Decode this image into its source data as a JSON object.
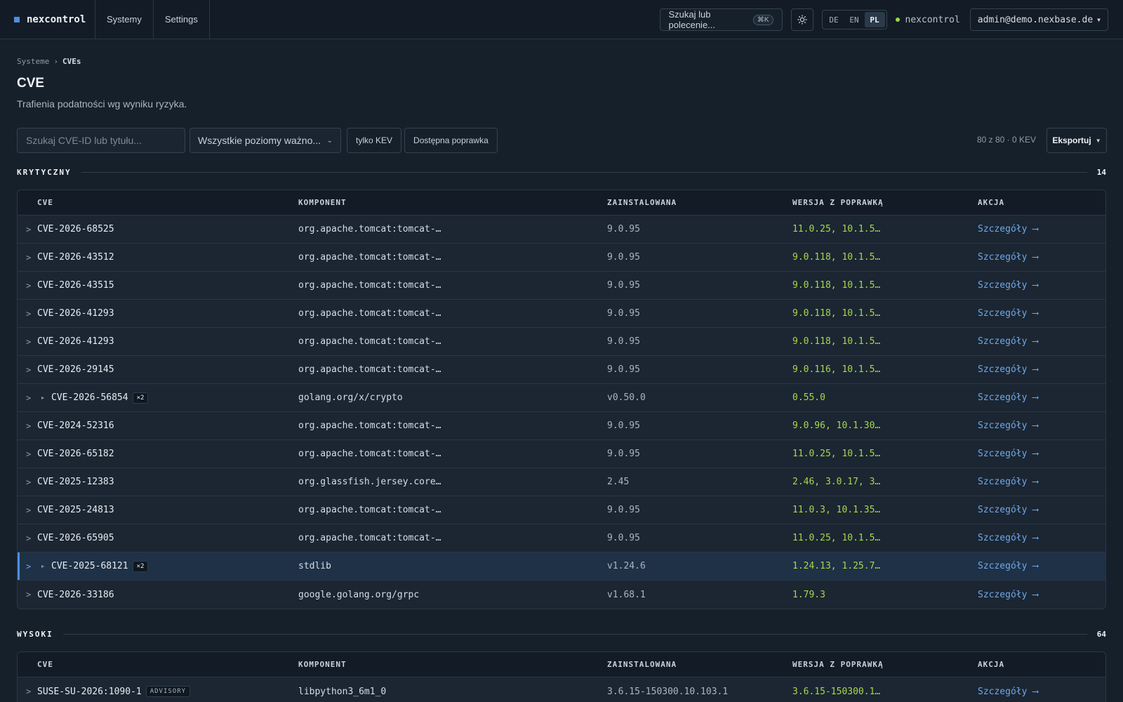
{
  "nav": {
    "brand": "nexcontrol",
    "items": [
      "Systemy",
      "Settings"
    ],
    "search_label": "Szukaj lub polecenie...",
    "search_kbd": "⌘K",
    "theme_icon": "sun-icon",
    "languages": [
      "DE",
      "EN",
      "PL"
    ],
    "active_language": "PL",
    "status_label": "nexcontrol",
    "status_color": "#9bd849",
    "user": "admin@demo.nexbase.de"
  },
  "breadcrumb": {
    "parent": "Systeme",
    "separator": "›",
    "current": "CVEs"
  },
  "page": {
    "title": "CVE",
    "subtitle": "Trafienia podatności wg wyniku ryzyka."
  },
  "filters": {
    "search_placeholder": "Szukaj CVE-ID lub tytułu...",
    "severity_select": "Wszystkie poziomy ważno...",
    "kev_chip": "tylko KEV",
    "fix_chip": "Dostępna poprawka",
    "summary": "80 z 80 · 0 KEV",
    "export_label": "Eksportuj"
  },
  "columns": [
    "CVE",
    "KOMPONENT",
    "ZAINSTALOWANA",
    "WERSJA Z POPRAWKĄ",
    "AKCJA"
  ],
  "sections": [
    {
      "label": "KRYTYCZNY",
      "count": "14",
      "rows": [
        {
          "cve": "CVE-2026-68525",
          "component": "org.apache.tomcat:tomcat-…",
          "installed": "9.0.95",
          "fixed": "11.0.25, 10.1.5…",
          "action": "Szczegóły ⟶"
        },
        {
          "cve": "CVE-2026-43512",
          "component": "org.apache.tomcat:tomcat-…",
          "installed": "9.0.95",
          "fixed": "9.0.118, 10.1.5…",
          "action": "Szczegóły ⟶"
        },
        {
          "cve": "CVE-2026-43515",
          "component": "org.apache.tomcat:tomcat-…",
          "installed": "9.0.95",
          "fixed": "9.0.118, 10.1.5…",
          "action": "Szczegóły ⟶"
        },
        {
          "cve": "CVE-2026-41293",
          "component": "org.apache.tomcat:tomcat-…",
          "installed": "9.0.95",
          "fixed": "9.0.118, 10.1.5…",
          "action": "Szczegóły ⟶"
        },
        {
          "cve": "CVE-2026-41293",
          "component": "org.apache.tomcat:tomcat-…",
          "installed": "9.0.95",
          "fixed": "9.0.118, 10.1.5…",
          "action": "Szczegóły ⟶"
        },
        {
          "cve": "CVE-2026-29145",
          "component": "org.apache.tomcat:tomcat-…",
          "installed": "9.0.95",
          "fixed": "9.0.116, 10.1.5…",
          "action": "Szczegóły ⟶"
        },
        {
          "cve": "CVE-2026-56854",
          "component": "golang.org/x/crypto",
          "installed": "v0.50.0",
          "fixed": "0.55.0",
          "action": "Szczegóły ⟶",
          "group_badge": "×2"
        },
        {
          "cve": "CVE-2024-52316",
          "component": "org.apache.tomcat:tomcat-…",
          "installed": "9.0.95",
          "fixed": "9.0.96, 10.1.30…",
          "action": "Szczegóły ⟶"
        },
        {
          "cve": "CVE-2026-65182",
          "component": "org.apache.tomcat:tomcat-…",
          "installed": "9.0.95",
          "fixed": "11.0.25, 10.1.5…",
          "action": "Szczegóły ⟶"
        },
        {
          "cve": "CVE-2025-12383",
          "component": "org.glassfish.jersey.core…",
          "installed": "2.45",
          "fixed": "2.46, 3.0.17, 3…",
          "action": "Szczegóły ⟶"
        },
        {
          "cve": "CVE-2025-24813",
          "component": "org.apache.tomcat:tomcat-…",
          "installed": "9.0.95",
          "fixed": "11.0.3, 10.1.35…",
          "action": "Szczegóły ⟶"
        },
        {
          "cve": "CVE-2026-65905",
          "component": "org.apache.tomcat:tomcat-…",
          "installed": "9.0.95",
          "fixed": "11.0.25, 10.1.5…",
          "action": "Szczegóły ⟶"
        },
        {
          "cve": "CVE-2025-68121",
          "component": "stdlib",
          "installed": "v1.24.6",
          "fixed": "1.24.13, 1.25.7…",
          "action": "Szczegóły ⟶",
          "group_badge": "×2",
          "selected": true
        },
        {
          "cve": "CVE-2026-33186",
          "component": "google.golang.org/grpc",
          "installed": "v1.68.1",
          "fixed": "1.79.3",
          "action": "Szczegóły ⟶"
        }
      ]
    },
    {
      "label": "WYSOKI",
      "count": "64",
      "rows": [
        {
          "cve": "SUSE-SU-2026:1090-1",
          "component": "libpython3_6m1_0",
          "installed": "3.6.15-150300.10.103.1",
          "fixed": "3.6.15-150300.1…",
          "action": "Szczegóły ⟶",
          "advisory_badge": "ADVISORY"
        }
      ]
    }
  ],
  "colors": {
    "accent": "#4a90e2",
    "fix": "#a6d84a",
    "link": "#6fa7e8",
    "background": "#16202b"
  }
}
